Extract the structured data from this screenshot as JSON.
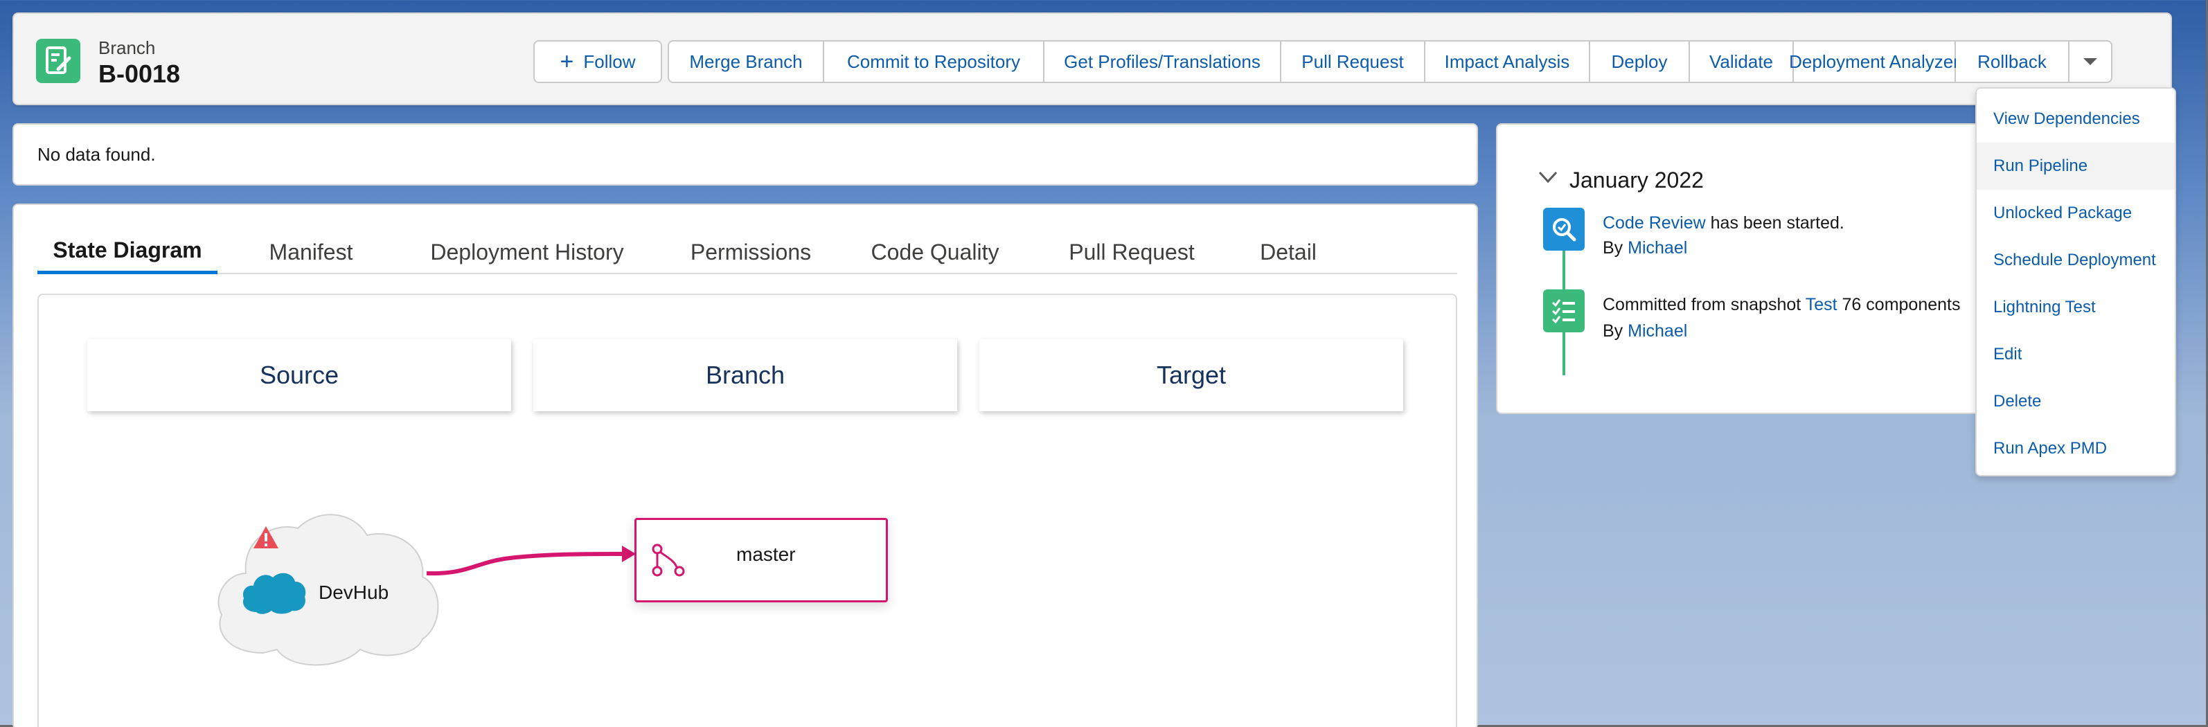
{
  "header": {
    "object_type": "Branch",
    "record_name": "B-0018",
    "follow_label": "Follow",
    "actions": [
      "Merge Branch",
      "Commit to Repository",
      "Get Profiles/Translations",
      "Pull Request",
      "Impact Analysis",
      "Deploy",
      "Validate",
      "Deployment Analyzer",
      "Rollback"
    ]
  },
  "menu": {
    "items": [
      "View Dependencies",
      "Run Pipeline",
      "Unlocked Package",
      "Schedule Deployment",
      "Lightning Test",
      "Edit",
      "Delete",
      "Run Apex PMD"
    ],
    "highlighted": "Run Pipeline"
  },
  "nodata": {
    "text": "No data found."
  },
  "tabs": [
    "State Diagram",
    "Manifest",
    "Deployment History",
    "Permissions",
    "Code Quality",
    "Pull Request",
    "Detail"
  ],
  "active_tab": "State Diagram",
  "diagram": {
    "columns": [
      "Source",
      "Branch",
      "Target"
    ],
    "source_node": "DevHub",
    "branch_node": "master",
    "source_status": "warning-icon"
  },
  "timeline": {
    "month": "January 2022",
    "events": [
      {
        "link": "Code Review",
        "text": "has been started.",
        "by_label": "By",
        "by": "Michael"
      },
      {
        "text": "Committed from snapshot",
        "link": "Test",
        "suffix": "76 components",
        "by_label": "By",
        "by": "Michael"
      }
    ]
  },
  "colors": {
    "brand_blue": "#0b5cab",
    "active_tab": "#0176d3",
    "branch_icon_green": "#3bba7c",
    "branch_node_border": "#d5166f",
    "review_icon": "#1f8fd8"
  }
}
